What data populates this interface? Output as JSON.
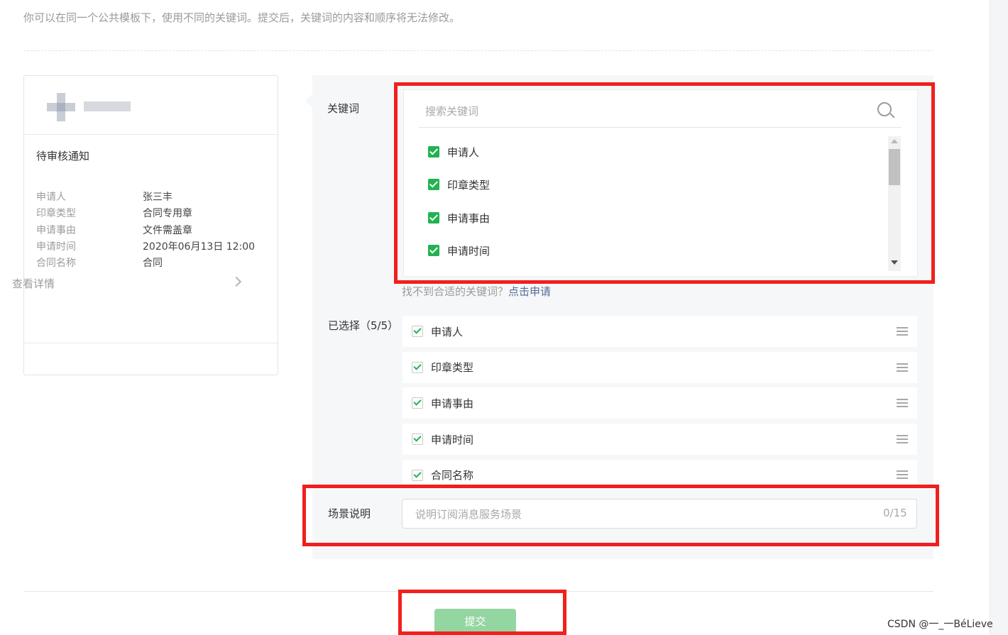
{
  "intro_text": "你可以在同一个公共模板下，使用不同的关键词。提交后，关键词的内容和顺序将无法修改。",
  "preview": {
    "title": "待审核通知",
    "fields": [
      {
        "key": "申请人",
        "value": "张三丰"
      },
      {
        "key": "印章类型",
        "value": "合同专用章"
      },
      {
        "key": "申请事由",
        "value": "文件需盖章"
      },
      {
        "key": "申请时间",
        "value": "2020年06月13日 12:00"
      },
      {
        "key": "合同名称",
        "value": "合同"
      }
    ],
    "detail_label": "查看详情"
  },
  "keywords": {
    "label": "关键词",
    "search_placeholder": "搜索关键词",
    "items": [
      {
        "label": "申请人",
        "checked": true
      },
      {
        "label": "印章类型",
        "checked": true
      },
      {
        "label": "申请事由",
        "checked": true
      },
      {
        "label": "申请时间",
        "checked": true
      }
    ],
    "hint_text": "找不到合适的关键词？",
    "hint_link": "点击申请"
  },
  "selected": {
    "label": "已选择（5/5）",
    "items": [
      {
        "label": "申请人",
        "checked": true
      },
      {
        "label": "印章类型",
        "checked": true
      },
      {
        "label": "申请事由",
        "checked": true
      },
      {
        "label": "申请时间",
        "checked": true
      },
      {
        "label": "合同名称",
        "checked": true
      }
    ]
  },
  "scene": {
    "label": "场景说明",
    "placeholder": "说明订阅消息服务场景",
    "counter": "0/15"
  },
  "submit_label": "提交",
  "watermark": "CSDN @一_一BéLieve",
  "colors": {
    "accent_green": "#21b34f",
    "submit_disabled": "#94d6a2",
    "annotation_red": "#f0201e",
    "link_blue": "#576b95"
  }
}
